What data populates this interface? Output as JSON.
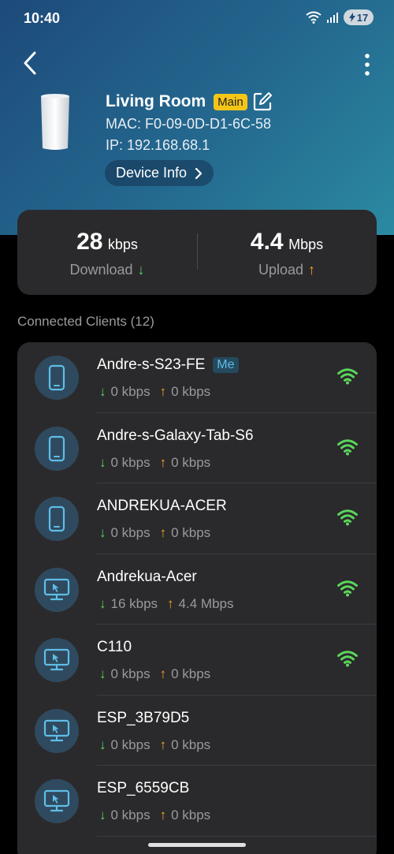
{
  "status_bar": {
    "time": "10:40",
    "battery": "17"
  },
  "device": {
    "name": "Living Room",
    "badge": "Main",
    "mac": "MAC: F0-09-0D-D1-6C-58",
    "ip": "IP: 192.168.68.1",
    "info_button": "Device Info"
  },
  "speeds": {
    "download": {
      "value": "28",
      "unit": "kbps",
      "label": "Download"
    },
    "upload": {
      "value": "4.4",
      "unit": "Mbps",
      "label": "Upload"
    }
  },
  "clients_section": {
    "title": "Connected Clients (12)"
  },
  "clients": [
    {
      "name": "Andre-s-S23-FE",
      "badge": "Me",
      "down": "0 kbps",
      "up": "0 kbps",
      "type": "phone",
      "wifi": true
    },
    {
      "name": "Andre-s-Galaxy-Tab-S6",
      "badge": "",
      "down": "0 kbps",
      "up": "0 kbps",
      "type": "phone",
      "wifi": true
    },
    {
      "name": "ANDREKUA-ACER",
      "badge": "",
      "down": "0 kbps",
      "up": "0 kbps",
      "type": "phone",
      "wifi": true
    },
    {
      "name": "Andrekua-Acer",
      "badge": "",
      "down": "16 kbps",
      "up": "4.4 Mbps",
      "type": "computer",
      "wifi": true
    },
    {
      "name": "C110",
      "badge": "",
      "down": "0 kbps",
      "up": "0 kbps",
      "type": "computer",
      "wifi": true
    },
    {
      "name": "ESP_3B79D5",
      "badge": "",
      "down": "0 kbps",
      "up": "0 kbps",
      "type": "computer",
      "wifi": false
    },
    {
      "name": "ESP_6559CB",
      "badge": "",
      "down": "0 kbps",
      "up": "0 kbps",
      "type": "computer",
      "wifi": false
    }
  ],
  "colors": {
    "download_arrow": "#5cd65c",
    "upload_arrow": "#f5a524",
    "wifi": "#5cd65c",
    "main_badge": "#f5c518"
  }
}
